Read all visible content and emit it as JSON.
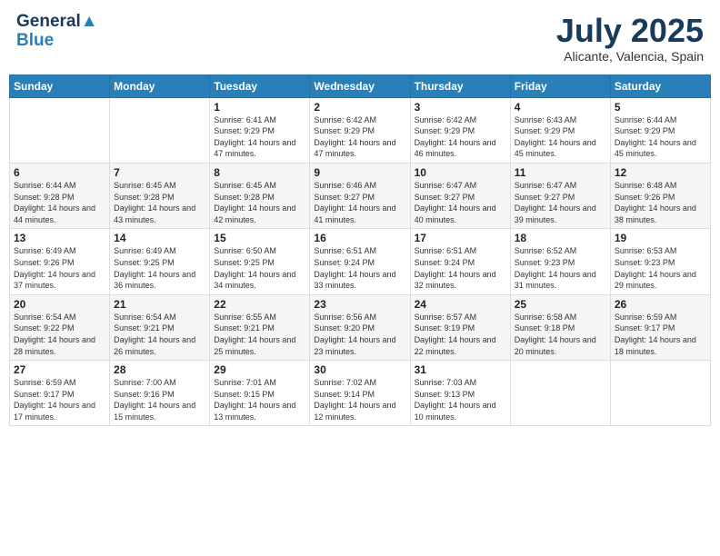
{
  "header": {
    "logo_line1": "General",
    "logo_line2": "Blue",
    "month": "July 2025",
    "location": "Alicante, Valencia, Spain"
  },
  "days_of_week": [
    "Sunday",
    "Monday",
    "Tuesday",
    "Wednesday",
    "Thursday",
    "Friday",
    "Saturday"
  ],
  "weeks": [
    [
      {
        "day": "",
        "info": ""
      },
      {
        "day": "",
        "info": ""
      },
      {
        "day": "1",
        "info": "Sunrise: 6:41 AM\nSunset: 9:29 PM\nDaylight: 14 hours and 47 minutes."
      },
      {
        "day": "2",
        "info": "Sunrise: 6:42 AM\nSunset: 9:29 PM\nDaylight: 14 hours and 47 minutes."
      },
      {
        "day": "3",
        "info": "Sunrise: 6:42 AM\nSunset: 9:29 PM\nDaylight: 14 hours and 46 minutes."
      },
      {
        "day": "4",
        "info": "Sunrise: 6:43 AM\nSunset: 9:29 PM\nDaylight: 14 hours and 45 minutes."
      },
      {
        "day": "5",
        "info": "Sunrise: 6:44 AM\nSunset: 9:29 PM\nDaylight: 14 hours and 45 minutes."
      }
    ],
    [
      {
        "day": "6",
        "info": "Sunrise: 6:44 AM\nSunset: 9:28 PM\nDaylight: 14 hours and 44 minutes."
      },
      {
        "day": "7",
        "info": "Sunrise: 6:45 AM\nSunset: 9:28 PM\nDaylight: 14 hours and 43 minutes."
      },
      {
        "day": "8",
        "info": "Sunrise: 6:45 AM\nSunset: 9:28 PM\nDaylight: 14 hours and 42 minutes."
      },
      {
        "day": "9",
        "info": "Sunrise: 6:46 AM\nSunset: 9:27 PM\nDaylight: 14 hours and 41 minutes."
      },
      {
        "day": "10",
        "info": "Sunrise: 6:47 AM\nSunset: 9:27 PM\nDaylight: 14 hours and 40 minutes."
      },
      {
        "day": "11",
        "info": "Sunrise: 6:47 AM\nSunset: 9:27 PM\nDaylight: 14 hours and 39 minutes."
      },
      {
        "day": "12",
        "info": "Sunrise: 6:48 AM\nSunset: 9:26 PM\nDaylight: 14 hours and 38 minutes."
      }
    ],
    [
      {
        "day": "13",
        "info": "Sunrise: 6:49 AM\nSunset: 9:26 PM\nDaylight: 14 hours and 37 minutes."
      },
      {
        "day": "14",
        "info": "Sunrise: 6:49 AM\nSunset: 9:25 PM\nDaylight: 14 hours and 36 minutes."
      },
      {
        "day": "15",
        "info": "Sunrise: 6:50 AM\nSunset: 9:25 PM\nDaylight: 14 hours and 34 minutes."
      },
      {
        "day": "16",
        "info": "Sunrise: 6:51 AM\nSunset: 9:24 PM\nDaylight: 14 hours and 33 minutes."
      },
      {
        "day": "17",
        "info": "Sunrise: 6:51 AM\nSunset: 9:24 PM\nDaylight: 14 hours and 32 minutes."
      },
      {
        "day": "18",
        "info": "Sunrise: 6:52 AM\nSunset: 9:23 PM\nDaylight: 14 hours and 31 minutes."
      },
      {
        "day": "19",
        "info": "Sunrise: 6:53 AM\nSunset: 9:23 PM\nDaylight: 14 hours and 29 minutes."
      }
    ],
    [
      {
        "day": "20",
        "info": "Sunrise: 6:54 AM\nSunset: 9:22 PM\nDaylight: 14 hours and 28 minutes."
      },
      {
        "day": "21",
        "info": "Sunrise: 6:54 AM\nSunset: 9:21 PM\nDaylight: 14 hours and 26 minutes."
      },
      {
        "day": "22",
        "info": "Sunrise: 6:55 AM\nSunset: 9:21 PM\nDaylight: 14 hours and 25 minutes."
      },
      {
        "day": "23",
        "info": "Sunrise: 6:56 AM\nSunset: 9:20 PM\nDaylight: 14 hours and 23 minutes."
      },
      {
        "day": "24",
        "info": "Sunrise: 6:57 AM\nSunset: 9:19 PM\nDaylight: 14 hours and 22 minutes."
      },
      {
        "day": "25",
        "info": "Sunrise: 6:58 AM\nSunset: 9:18 PM\nDaylight: 14 hours and 20 minutes."
      },
      {
        "day": "26",
        "info": "Sunrise: 6:59 AM\nSunset: 9:17 PM\nDaylight: 14 hours and 18 minutes."
      }
    ],
    [
      {
        "day": "27",
        "info": "Sunrise: 6:59 AM\nSunset: 9:17 PM\nDaylight: 14 hours and 17 minutes."
      },
      {
        "day": "28",
        "info": "Sunrise: 7:00 AM\nSunset: 9:16 PM\nDaylight: 14 hours and 15 minutes."
      },
      {
        "day": "29",
        "info": "Sunrise: 7:01 AM\nSunset: 9:15 PM\nDaylight: 14 hours and 13 minutes."
      },
      {
        "day": "30",
        "info": "Sunrise: 7:02 AM\nSunset: 9:14 PM\nDaylight: 14 hours and 12 minutes."
      },
      {
        "day": "31",
        "info": "Sunrise: 7:03 AM\nSunset: 9:13 PM\nDaylight: 14 hours and 10 minutes."
      },
      {
        "day": "",
        "info": ""
      },
      {
        "day": "",
        "info": ""
      }
    ]
  ]
}
